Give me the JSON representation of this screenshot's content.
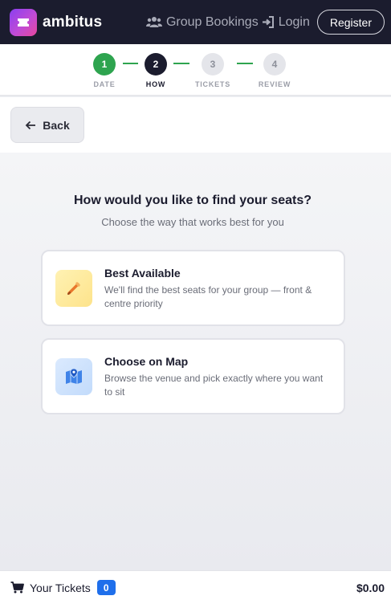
{
  "brand": {
    "name": "ambitus",
    "logo_icon": "ticket-icon",
    "accent_gradient": [
      "#8a3ff0",
      "#e8479b"
    ]
  },
  "nav": {
    "group_bookings": "Group Bookings",
    "login": "Login",
    "register": "Register"
  },
  "stepper": {
    "steps": [
      {
        "number": "1",
        "label": "DATE",
        "state": "done"
      },
      {
        "number": "2",
        "label": "HOW",
        "state": "active"
      },
      {
        "number": "3",
        "label": "TICKETS",
        "state": "todo"
      },
      {
        "number": "4",
        "label": "REVIEW",
        "state": "todo"
      }
    ],
    "colors": {
      "done": "#2ea44f",
      "active": "#1b1c2e",
      "todo": "#e4e5ea"
    }
  },
  "back": {
    "label": "Back"
  },
  "main": {
    "question": "How would you like to find your seats?",
    "subtitle": "Choose the way that works best for you",
    "options": [
      {
        "icon": "pencil-icon",
        "title": "Best Available",
        "description": "We'll find the best seats for your group — front & centre priority"
      },
      {
        "icon": "map-pin-icon",
        "title": "Choose on Map",
        "description": "Browse the venue and pick exactly where you want to sit"
      }
    ]
  },
  "footer": {
    "cart_label": "Your Tickets",
    "cart_count": "0",
    "total": "$0.00",
    "count_color": "#1f6feb"
  }
}
